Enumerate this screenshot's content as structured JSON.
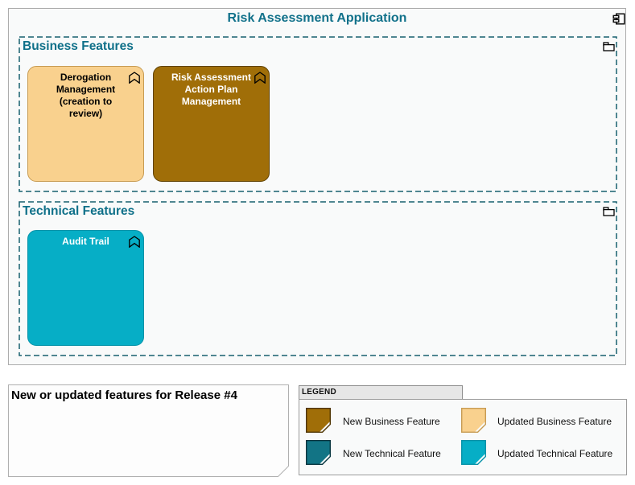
{
  "diagram": {
    "title": "Risk Assessment Application",
    "title_color": "#11718A",
    "dash_color": "#17606E",
    "label_color": "#0F7089"
  },
  "groups": [
    {
      "label": "Business Features"
    },
    {
      "label": "Technical Features"
    }
  ],
  "features": [
    {
      "name": "Derogation Management (creation to review)",
      "group": "Business Features",
      "fill": "#F9D18E",
      "border": "#C79B52",
      "text_color": "#000000"
    },
    {
      "name": "Risk Assessment Action Plan Management",
      "group": "Business Features",
      "fill": "#A06E08",
      "border": "#5F4100",
      "text_color": "#FFFFFF"
    },
    {
      "name": "Audit Trail",
      "group": "Technical Features",
      "fill": "#06AEC6",
      "border": "#0792A8",
      "text_color": "#FFFFFF"
    }
  ],
  "note": {
    "text": "New or updated features for Release #4"
  },
  "legend": {
    "title": "LEGEND",
    "items": [
      {
        "label": "New Business Feature",
        "fill": "#A06E08",
        "border": "#4D3300"
      },
      {
        "label": "Updated Business Feature",
        "fill": "#F9D18E",
        "border": "#C79B52"
      },
      {
        "label": "New Technical Feature",
        "fill": "#127485",
        "border": "#06353F"
      },
      {
        "label": "Updated Technical Feature",
        "fill": "#06AEC6",
        "border": "#0792A8"
      }
    ]
  }
}
